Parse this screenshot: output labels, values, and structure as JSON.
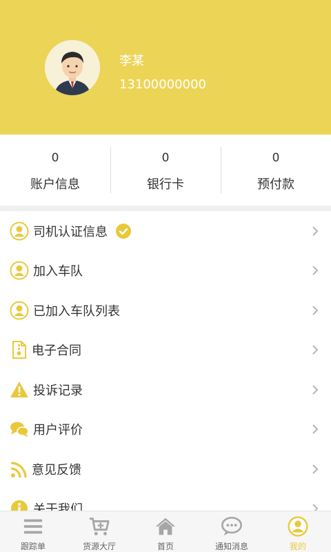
{
  "profile": {
    "name": "李某",
    "phone": "13100000000"
  },
  "stats": [
    {
      "value": "0",
      "label": "账户信息"
    },
    {
      "value": "0",
      "label": "银行卡"
    },
    {
      "value": "0",
      "label": "预付款"
    }
  ],
  "menu": {
    "items": [
      {
        "label": "司机认证信息",
        "icon": "user-circle-icon"
      },
      {
        "label": "加入车队",
        "icon": "user-circle-icon"
      },
      {
        "label": "已加入车队列表",
        "icon": "user-circle-icon"
      },
      {
        "label": "电子合同",
        "icon": "document-icon"
      },
      {
        "label": "投诉记录",
        "icon": "warning-icon"
      },
      {
        "label": "用户评价",
        "icon": "chat-icon"
      },
      {
        "label": "意见反馈",
        "icon": "rss-icon"
      },
      {
        "label": "关于我们",
        "icon": "info-icon"
      }
    ]
  },
  "tabbar": {
    "tabs": [
      {
        "label": "跟踪单",
        "icon": "list-icon"
      },
      {
        "label": "货源大厅",
        "icon": "cart-icon"
      },
      {
        "label": "首页",
        "icon": "home-icon"
      },
      {
        "label": "通知消息",
        "icon": "message-icon"
      },
      {
        "label": "我的",
        "icon": "user-icon"
      }
    ],
    "active_index": 4
  },
  "colors": {
    "header": "#ECD457",
    "accent": "#E8C93C",
    "tab_inactive": "#A6A6A6"
  }
}
